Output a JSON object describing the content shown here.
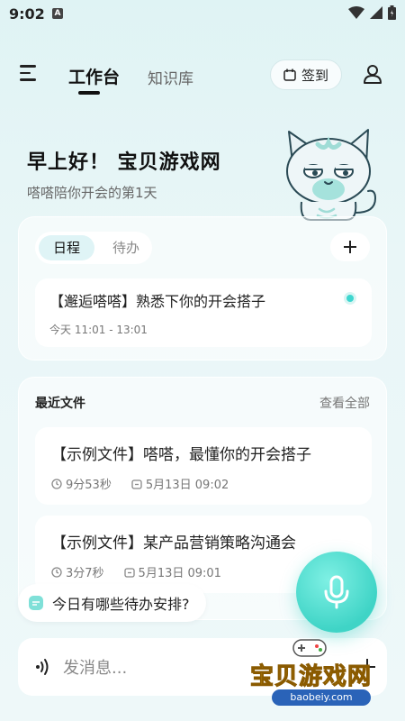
{
  "status_bar": {
    "time": "9:02",
    "notification_badge": "A"
  },
  "nav": {
    "tabs": [
      {
        "label": "工作台",
        "active": true
      },
      {
        "label": "知识库",
        "active": false
      }
    ],
    "checkin_label": "签到"
  },
  "hero": {
    "greeting": "早上好！ 宝贝游戏网",
    "subtitle": "嗒嗒陪你开会的第1天"
  },
  "schedule": {
    "segments": [
      {
        "label": "日程",
        "active": true
      },
      {
        "label": "待办",
        "active": false
      }
    ],
    "event": {
      "title": "【邂逅嗒嗒】熟悉下你的开会搭子",
      "time": "今天 11:01 - 13:01"
    }
  },
  "recent_files": {
    "title": "最近文件",
    "view_all": "查看全部",
    "files": [
      {
        "title": "【示例文件】嗒嗒，最懂你的开会搭子",
        "duration": "9分53秒",
        "date": "5月13日 09:02"
      },
      {
        "title": "【示例文件】某产品营销策略沟通会",
        "duration": "3分7秒",
        "date": "5月13日 09:01"
      }
    ]
  },
  "suggestion": "今日有哪些待办安排?",
  "input": {
    "placeholder": "发消息..."
  },
  "watermark": {
    "brand": "宝贝游戏网",
    "url": "baobeiy.com"
  },
  "colors": {
    "accent": "#3fd4c6",
    "background": "#e9f6f7",
    "brand_yellow": "#f5c218"
  }
}
